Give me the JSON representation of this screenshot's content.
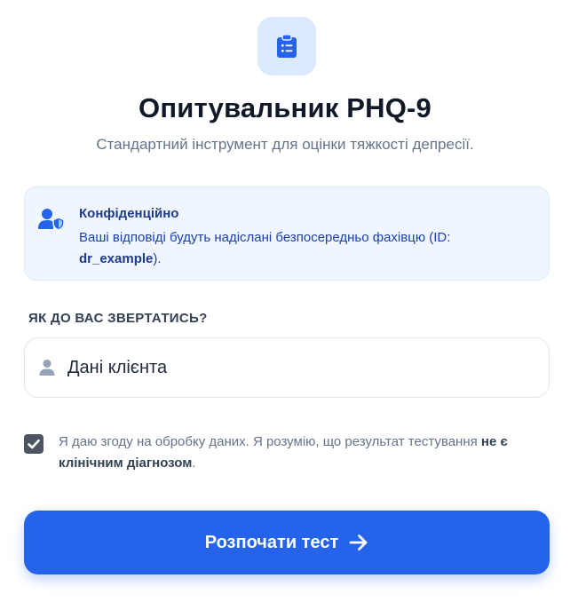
{
  "header": {
    "logo_icon": "clipboard-list-icon",
    "title": "Опитувальник PHQ-9",
    "subtitle": "Стандартний інструмент для оцінки тяжкості депресії."
  },
  "notice": {
    "icon": "user-shield-icon",
    "title": "Конфіденційно",
    "text_before": "Ваші відповіді будуть надіслані безпосередньо фахівцю (ID: ",
    "specialist_id": "dr_example",
    "text_after": ")."
  },
  "name_field": {
    "label": "ЯК ДО ВАС ЗВЕРТАТИСЬ?",
    "icon": "user-icon",
    "placeholder": "Дані клієнта",
    "value": ""
  },
  "consent": {
    "checked": true,
    "text": "Я даю згоду на обробку даних. Я розумію, що результат тестування ",
    "emphasis": "не є клінічним діагнозом",
    "text_end": "."
  },
  "start_button": {
    "label": "Розпочати тест",
    "icon": "arrow-right-icon"
  },
  "colors": {
    "primary": "#2563eb",
    "notice_bg": "#eff6ff",
    "notice_title": "#1e3a8a",
    "muted_text": "#64748b",
    "checkbox": "#4b5563"
  }
}
